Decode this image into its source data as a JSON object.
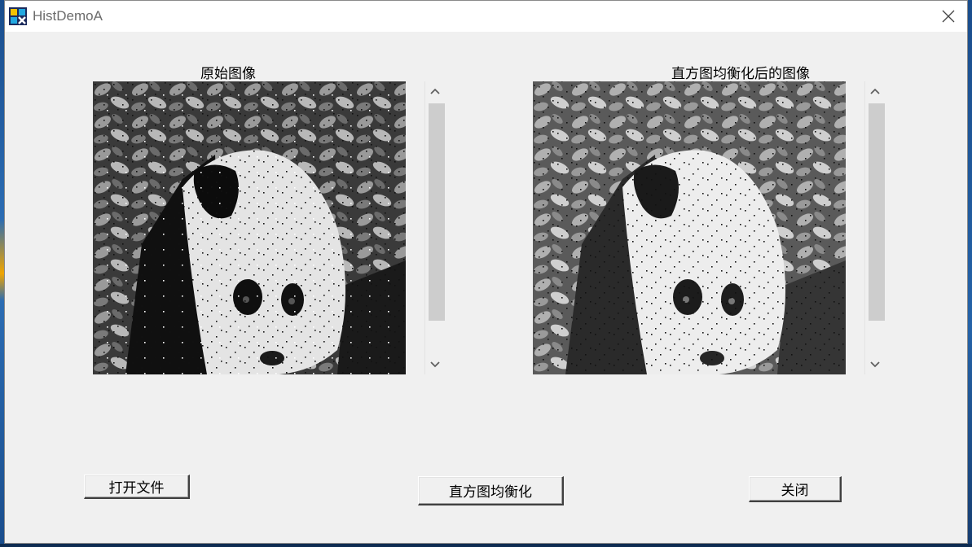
{
  "window": {
    "title": "HistDemoA"
  },
  "left_panel": {
    "label": "原始图像"
  },
  "right_panel": {
    "label": "直方图均衡化后的图像"
  },
  "buttons": {
    "open_file": "打开文件",
    "equalize": "直方图均衡化",
    "close": "关闭"
  },
  "icons": {
    "app": "app-icon",
    "close": "close-icon",
    "scroll_up": "chevron-up-icon",
    "scroll_down": "chevron-down-icon"
  },
  "colors": {
    "window_bg": "#f0f0f0",
    "titlebar_bg": "#ffffff",
    "scroll_thumb": "#cdcdcd"
  }
}
